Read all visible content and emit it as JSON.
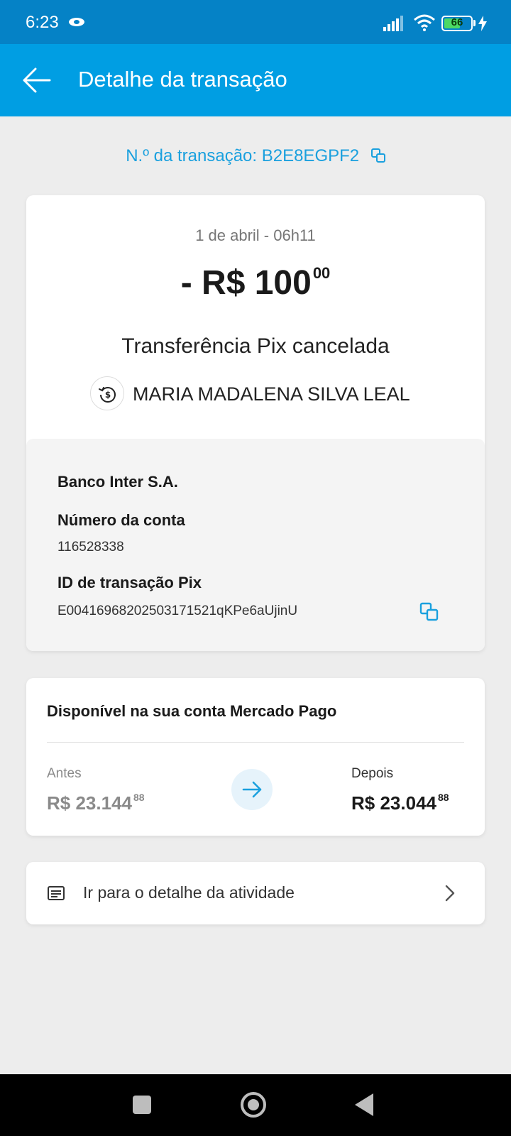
{
  "status_bar": {
    "time": "6:23",
    "battery": "66"
  },
  "app_bar": {
    "title": "Detalhe da transação"
  },
  "transaction": {
    "number_label": "N.º da transação: B2E8EGPF2",
    "date": "1 de abril - 06h11",
    "amount_main": "- R$ 100",
    "amount_cents": "00",
    "status": "Transferência Pix cancelada",
    "recipient_name": "MARIA MADALENA SILVA LEAL"
  },
  "details": {
    "bank": "Banco Inter S.A.",
    "account_label": "Número da conta",
    "account_value": "116528338",
    "pix_id_label": "ID de transação Pix",
    "pix_id_value": "E00416968202503171521qKPe6aUjinU"
  },
  "balance": {
    "title": "Disponível na sua conta Mercado Pago",
    "before_label": "Antes",
    "before_main": "R$ 23.144",
    "before_cents": "88",
    "after_label": "Depois",
    "after_main": "R$ 23.044",
    "after_cents": "88"
  },
  "activity_link": {
    "label": "Ir para o detalhe da atividade"
  },
  "colors": {
    "status_bar": "#0582c6",
    "app_bar": "#009ee3",
    "accent_link": "#1aa0de",
    "background": "#ededed"
  },
  "icons": {
    "back": "arrow-left-icon",
    "copy": "copy-icon",
    "recipient": "money-refund-icon",
    "balance_arrow": "arrow-right-icon",
    "activity": "receipt-icon",
    "chevron": "chevron-right-icon"
  }
}
